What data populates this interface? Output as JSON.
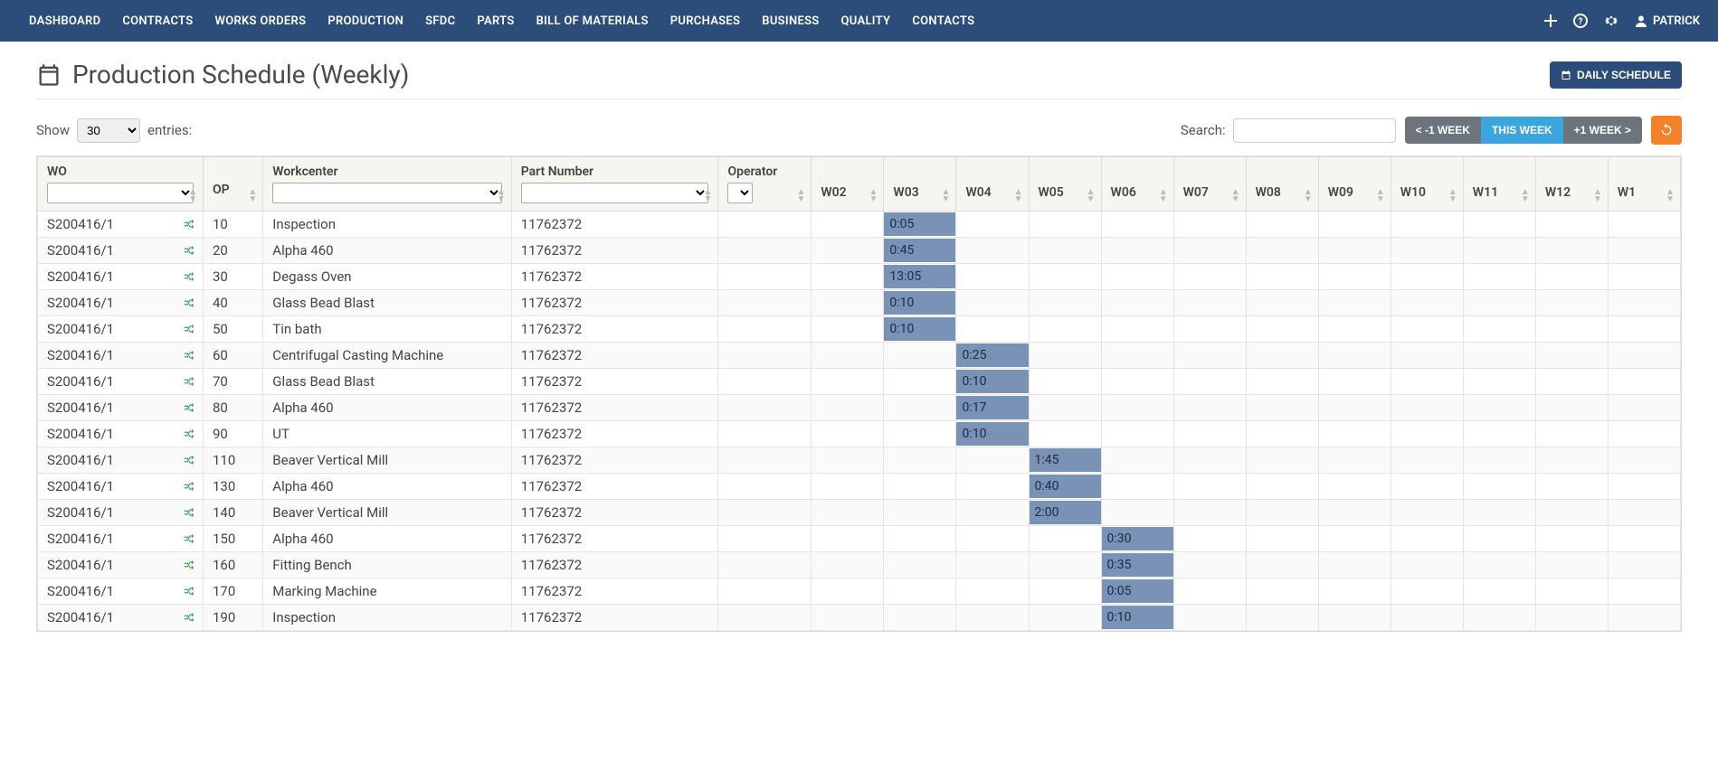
{
  "nav": {
    "items": [
      "DASHBOARD",
      "CONTRACTS",
      "WORKS ORDERS",
      "PRODUCTION",
      "SFDC",
      "PARTS",
      "BILL OF MATERIALS",
      "PURCHASES",
      "BUSINESS",
      "QUALITY",
      "CONTACTS"
    ],
    "user": "PATRICK"
  },
  "page": {
    "title": "Production Schedule (Weekly)",
    "daily_btn": "DAILY SCHEDULE"
  },
  "controls": {
    "show_label_pre": "Show",
    "show_value": "30",
    "show_label_post": "entries:",
    "search_label": "Search:",
    "week_prev": "< -1 WEEK",
    "week_this": "THIS WEEK",
    "week_next": "+1 WEEK >"
  },
  "columns": {
    "wo": "WO",
    "op": "OP",
    "wc": "Workcenter",
    "pn": "Part Number",
    "operator": "Operator",
    "weeks": [
      "W02",
      "W03",
      "W04",
      "W05",
      "W06",
      "W07",
      "W08",
      "W09",
      "W10",
      "W11",
      "W12",
      "W1"
    ]
  },
  "rows": [
    {
      "wo": "S200416/1",
      "op": "10",
      "wc": "Inspection",
      "pn": "11762372",
      "times": {
        "W03": "0:05"
      }
    },
    {
      "wo": "S200416/1",
      "op": "20",
      "wc": "Alpha 460",
      "pn": "11762372",
      "times": {
        "W03": "0:45"
      }
    },
    {
      "wo": "S200416/1",
      "op": "30",
      "wc": "Degass Oven",
      "pn": "11762372",
      "times": {
        "W03": "13:05"
      }
    },
    {
      "wo": "S200416/1",
      "op": "40",
      "wc": "Glass Bead Blast",
      "pn": "11762372",
      "times": {
        "W03": "0:10"
      }
    },
    {
      "wo": "S200416/1",
      "op": "50",
      "wc": "Tin bath",
      "pn": "11762372",
      "times": {
        "W03": "0:10"
      }
    },
    {
      "wo": "S200416/1",
      "op": "60",
      "wc": "Centrifugal Casting Machine",
      "pn": "11762372",
      "times": {
        "W04": "0:25"
      }
    },
    {
      "wo": "S200416/1",
      "op": "70",
      "wc": "Glass Bead Blast",
      "pn": "11762372",
      "times": {
        "W04": "0:10"
      }
    },
    {
      "wo": "S200416/1",
      "op": "80",
      "wc": "Alpha 460",
      "pn": "11762372",
      "times": {
        "W04": "0:17"
      }
    },
    {
      "wo": "S200416/1",
      "op": "90",
      "wc": "UT",
      "pn": "11762372",
      "times": {
        "W04": "0:10"
      }
    },
    {
      "wo": "S200416/1",
      "op": "110",
      "wc": "Beaver Vertical Mill",
      "pn": "11762372",
      "times": {
        "W05": "1:45"
      }
    },
    {
      "wo": "S200416/1",
      "op": "130",
      "wc": "Alpha 460",
      "pn": "11762372",
      "times": {
        "W05": "0:40"
      }
    },
    {
      "wo": "S200416/1",
      "op": "140",
      "wc": "Beaver Vertical Mill",
      "pn": "11762372",
      "times": {
        "W05": "2:00"
      }
    },
    {
      "wo": "S200416/1",
      "op": "150",
      "wc": "Alpha 460",
      "pn": "11762372",
      "times": {
        "W06": "0:30"
      }
    },
    {
      "wo": "S200416/1",
      "op": "160",
      "wc": "Fitting Bench",
      "pn": "11762372",
      "times": {
        "W06": "0:35"
      }
    },
    {
      "wo": "S200416/1",
      "op": "170",
      "wc": "Marking Machine",
      "pn": "11762372",
      "times": {
        "W06": "0:05"
      }
    },
    {
      "wo": "S200416/1",
      "op": "190",
      "wc": "Inspection",
      "pn": "11762372",
      "times": {
        "W06": "0:10"
      }
    }
  ]
}
